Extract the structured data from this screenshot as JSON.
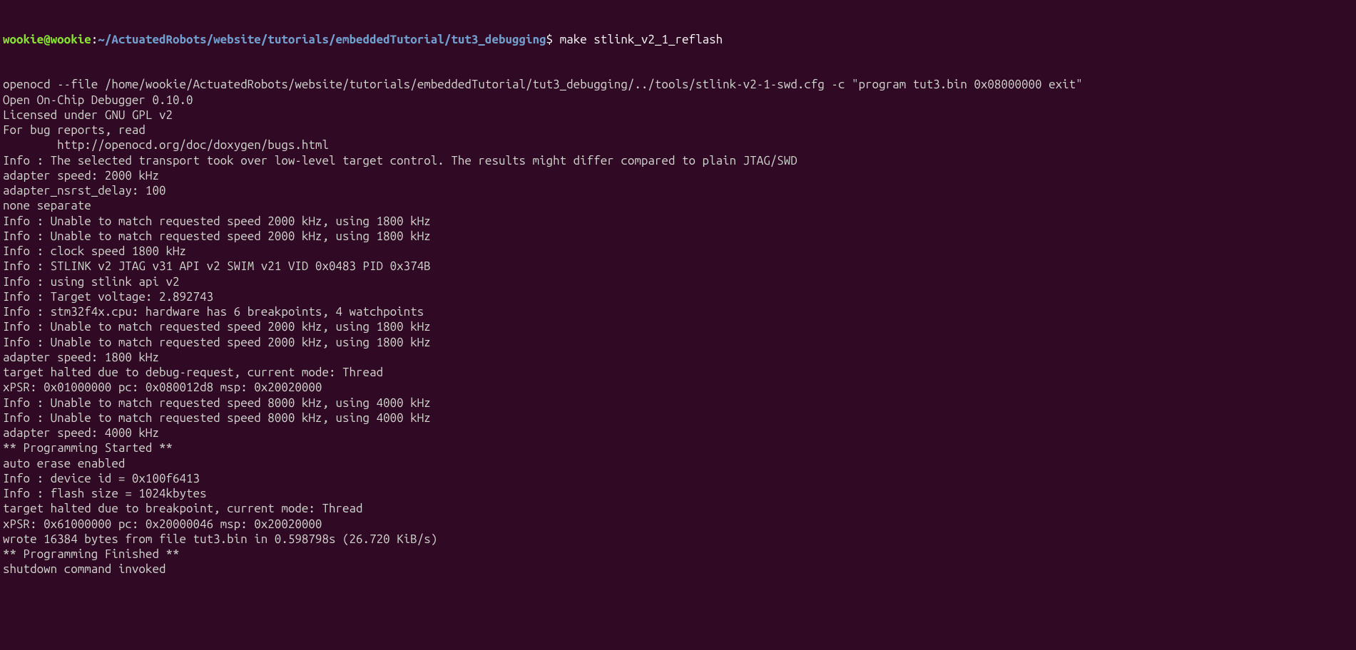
{
  "prompt": {
    "user": "wookie@wookie",
    "colon": ":",
    "path": "~/ActuatedRobots/website/tutorials/embeddedTutorial/tut3_debugging",
    "dollar": "$",
    "command": " make stlink_v2_1_reflash"
  },
  "output": {
    "lines": [
      "openocd --file /home/wookie/ActuatedRobots/website/tutorials/embeddedTutorial/tut3_debugging/../tools/stlink-v2-1-swd.cfg -c \"program tut3.bin 0x08000000 exit\"",
      "Open On-Chip Debugger 0.10.0",
      "Licensed under GNU GPL v2",
      "For bug reports, read",
      "        http://openocd.org/doc/doxygen/bugs.html",
      "Info : The selected transport took over low-level target control. The results might differ compared to plain JTAG/SWD",
      "adapter speed: 2000 kHz",
      "adapter_nsrst_delay: 100",
      "none separate",
      "Info : Unable to match requested speed 2000 kHz, using 1800 kHz",
      "Info : Unable to match requested speed 2000 kHz, using 1800 kHz",
      "Info : clock speed 1800 kHz",
      "Info : STLINK v2 JTAG v31 API v2 SWIM v21 VID 0x0483 PID 0x374B",
      "Info : using stlink api v2",
      "Info : Target voltage: 2.892743",
      "Info : stm32f4x.cpu: hardware has 6 breakpoints, 4 watchpoints",
      "Info : Unable to match requested speed 2000 kHz, using 1800 kHz",
      "Info : Unable to match requested speed 2000 kHz, using 1800 kHz",
      "adapter speed: 1800 kHz",
      "target halted due to debug-request, current mode: Thread",
      "xPSR: 0x01000000 pc: 0x080012d8 msp: 0x20020000",
      "Info : Unable to match requested speed 8000 kHz, using 4000 kHz",
      "Info : Unable to match requested speed 8000 kHz, using 4000 kHz",
      "adapter speed: 4000 kHz",
      "** Programming Started **",
      "auto erase enabled",
      "Info : device id = 0x100f6413",
      "Info : flash size = 1024kbytes",
      "target halted due to breakpoint, current mode: Thread",
      "xPSR: 0x61000000 pc: 0x20000046 msp: 0x20020000",
      "wrote 16384 bytes from file tut3.bin in 0.598798s (26.720 KiB/s)",
      "** Programming Finished **",
      "shutdown command invoked"
    ]
  }
}
